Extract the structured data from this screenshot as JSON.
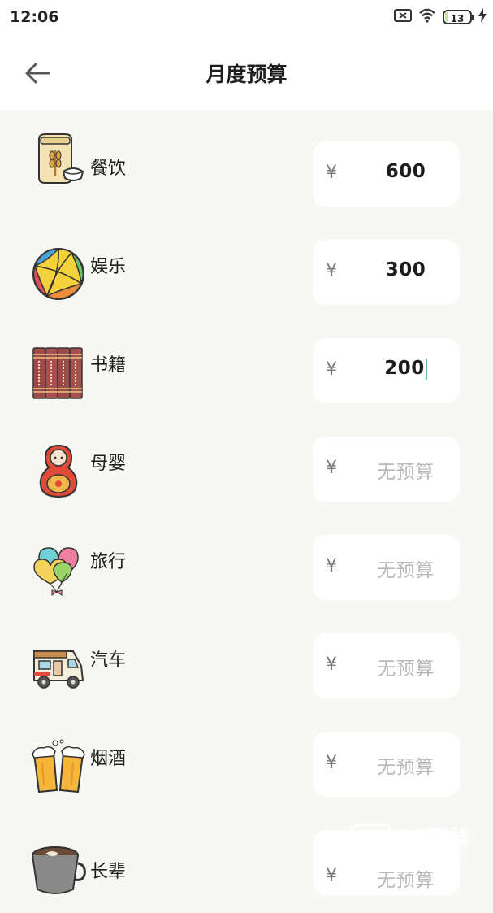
{
  "status_bar": {
    "time": "12:06",
    "battery": "13",
    "battery_level_percent": 13,
    "icons": [
      "sim-x-icon",
      "wifi-icon",
      "battery-icon",
      "charging-bolt-icon"
    ]
  },
  "header": {
    "title": "月度预算",
    "back_icon": "arrow-left-icon"
  },
  "currency_symbol": "¥",
  "categories": [
    {
      "label": "餐饮",
      "amount": "600",
      "icon": "grain-sack-icon"
    },
    {
      "label": "娱乐",
      "amount": "300",
      "icon": "beach-ball-icon"
    },
    {
      "label": "书籍",
      "amount": "200",
      "icon": "books-icon",
      "focused": true
    },
    {
      "label": "母婴",
      "amount": "无预算",
      "icon": "nesting-doll-icon"
    },
    {
      "label": "旅行",
      "amount": "无预算",
      "icon": "heart-balloons-icon"
    },
    {
      "label": "汽车",
      "amount": "无预算",
      "icon": "camper-van-icon"
    },
    {
      "label": "烟酒",
      "amount": "无预算",
      "icon": "beer-cheers-icon"
    },
    {
      "label": "长辈",
      "amount": "无预算",
      "icon": "coffee-cup-icon"
    }
  ],
  "watermark": {
    "badge": "55",
    "title": "55下载",
    "subtitle": "PP55.COM"
  },
  "colors": {
    "background": "#f7f7f3",
    "card": "#ffffff",
    "caret": "#6cbca8",
    "placeholder": "#b7b7b7"
  }
}
